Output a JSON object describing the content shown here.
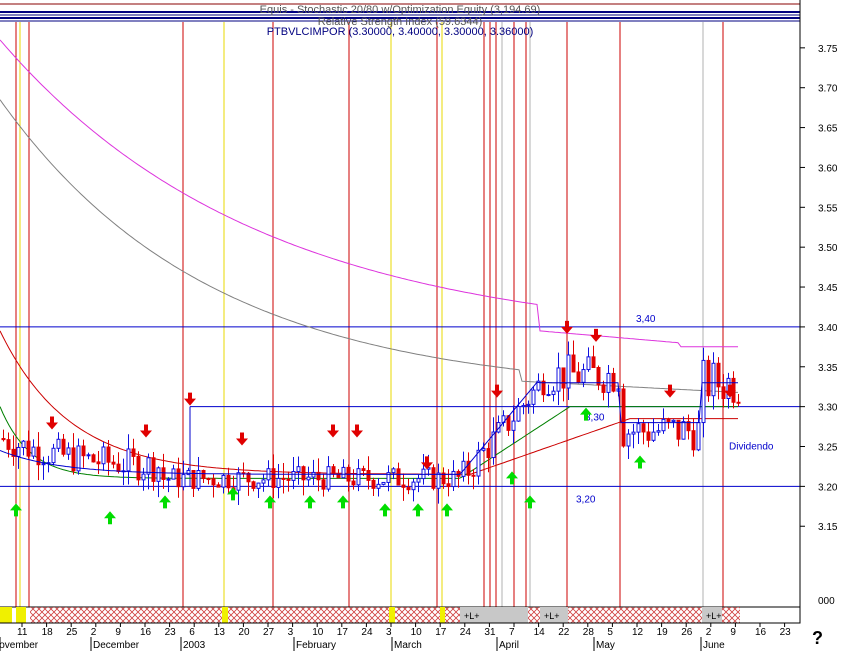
{
  "header": {
    "line1": "Equis - Stochastic 20/80  w/Optimization Equity (3,194.69)",
    "line2": "Relative Strength Index (59.6344)",
    "line3": "PTBVLCIMPOR (3.30000, 3.40000, 3.30000, 3.36000)"
  },
  "help_label": "?",
  "colors": {
    "price_up": "#1010e0",
    "price_down": "#e00000",
    "buy_arrow": "#00dd00",
    "sell_arrow": "#e00000",
    "magenta_ma": "#dd33dd",
    "gray_ma": "#808080",
    "red_ma": "#cc0000",
    "green_ma": "#008000",
    "blue_ma": "#0000cc",
    "signal_line": "#cc0000",
    "hline": "#0000cc"
  },
  "chart_data": {
    "type": "candlestick",
    "ylim": [
      3.06,
      3.81
    ],
    "y_ticks": [
      "3.15",
      "3.20",
      "3.25",
      "3.30",
      "3.35",
      "3.40",
      "3.45",
      "3.50",
      "3.55",
      "3.60",
      "3.65",
      "3.70",
      "3.75"
    ],
    "volume_label": "000",
    "horizontal_levels": [
      {
        "value": 3.4,
        "label": "3,40"
      },
      {
        "value": 3.3,
        "label": "3,30"
      },
      {
        "value": 3.2,
        "label": "3,20"
      }
    ],
    "annotation": "Dividendo",
    "x_day_ticks": [
      "11",
      "18",
      "25",
      "2",
      "9",
      "16",
      "23",
      "6",
      "13",
      "20",
      "27",
      "3",
      "10",
      "17",
      "24",
      "3",
      "10",
      "17",
      "24",
      "31",
      "7",
      "14",
      "22",
      "28",
      "5",
      "12",
      "19",
      "26",
      "2",
      "9",
      "16",
      "23"
    ],
    "x_month_labels": [
      "November",
      "December",
      "2003",
      "February",
      "March",
      "April",
      "May",
      "June"
    ],
    "trade_markers": [
      "+L+",
      "+L+",
      "+L+"
    ],
    "ohlc_sample_last": {
      "open": 3.3,
      "high": 3.4,
      "low": 3.3,
      "close": 3.36
    }
  }
}
